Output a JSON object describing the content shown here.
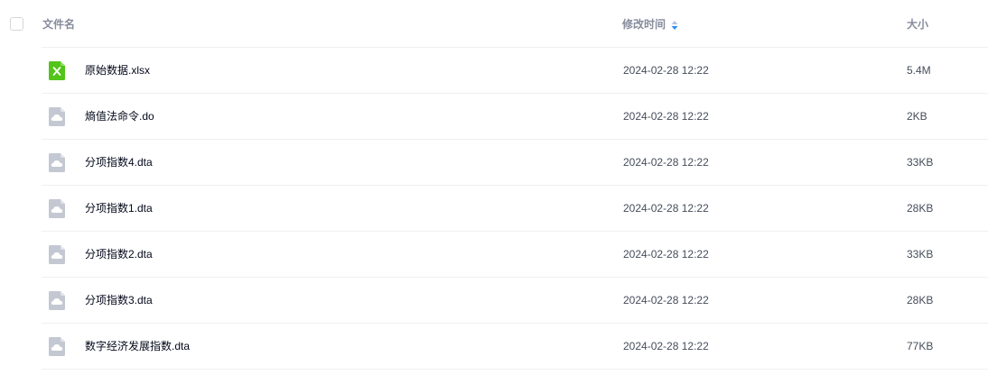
{
  "header": {
    "name_label": "文件名",
    "time_label": "修改时间",
    "size_label": "大小"
  },
  "colors": {
    "sort_up": "#b6c3e0",
    "sort_down": "#2f8cf3",
    "excel_icon": "#52c41a",
    "generic_icon": "#c4c8d2"
  },
  "files": [
    {
      "name": "原始数据.xlsx",
      "modified": "2024-02-28 12:22",
      "size": "5.4M",
      "icon": "excel-file-icon"
    },
    {
      "name": "熵值法命令.do",
      "modified": "2024-02-28 12:22",
      "size": "2KB",
      "icon": "cloud-file-icon"
    },
    {
      "name": "分项指数4.dta",
      "modified": "2024-02-28 12:22",
      "size": "33KB",
      "icon": "cloud-file-icon"
    },
    {
      "name": "分项指数1.dta",
      "modified": "2024-02-28 12:22",
      "size": "28KB",
      "icon": "cloud-file-icon"
    },
    {
      "name": "分项指数2.dta",
      "modified": "2024-02-28 12:22",
      "size": "33KB",
      "icon": "cloud-file-icon"
    },
    {
      "name": "分项指数3.dta",
      "modified": "2024-02-28 12:22",
      "size": "28KB",
      "icon": "cloud-file-icon"
    },
    {
      "name": "数字经济发展指数.dta",
      "modified": "2024-02-28 12:22",
      "size": "77KB",
      "icon": "cloud-file-icon"
    }
  ]
}
